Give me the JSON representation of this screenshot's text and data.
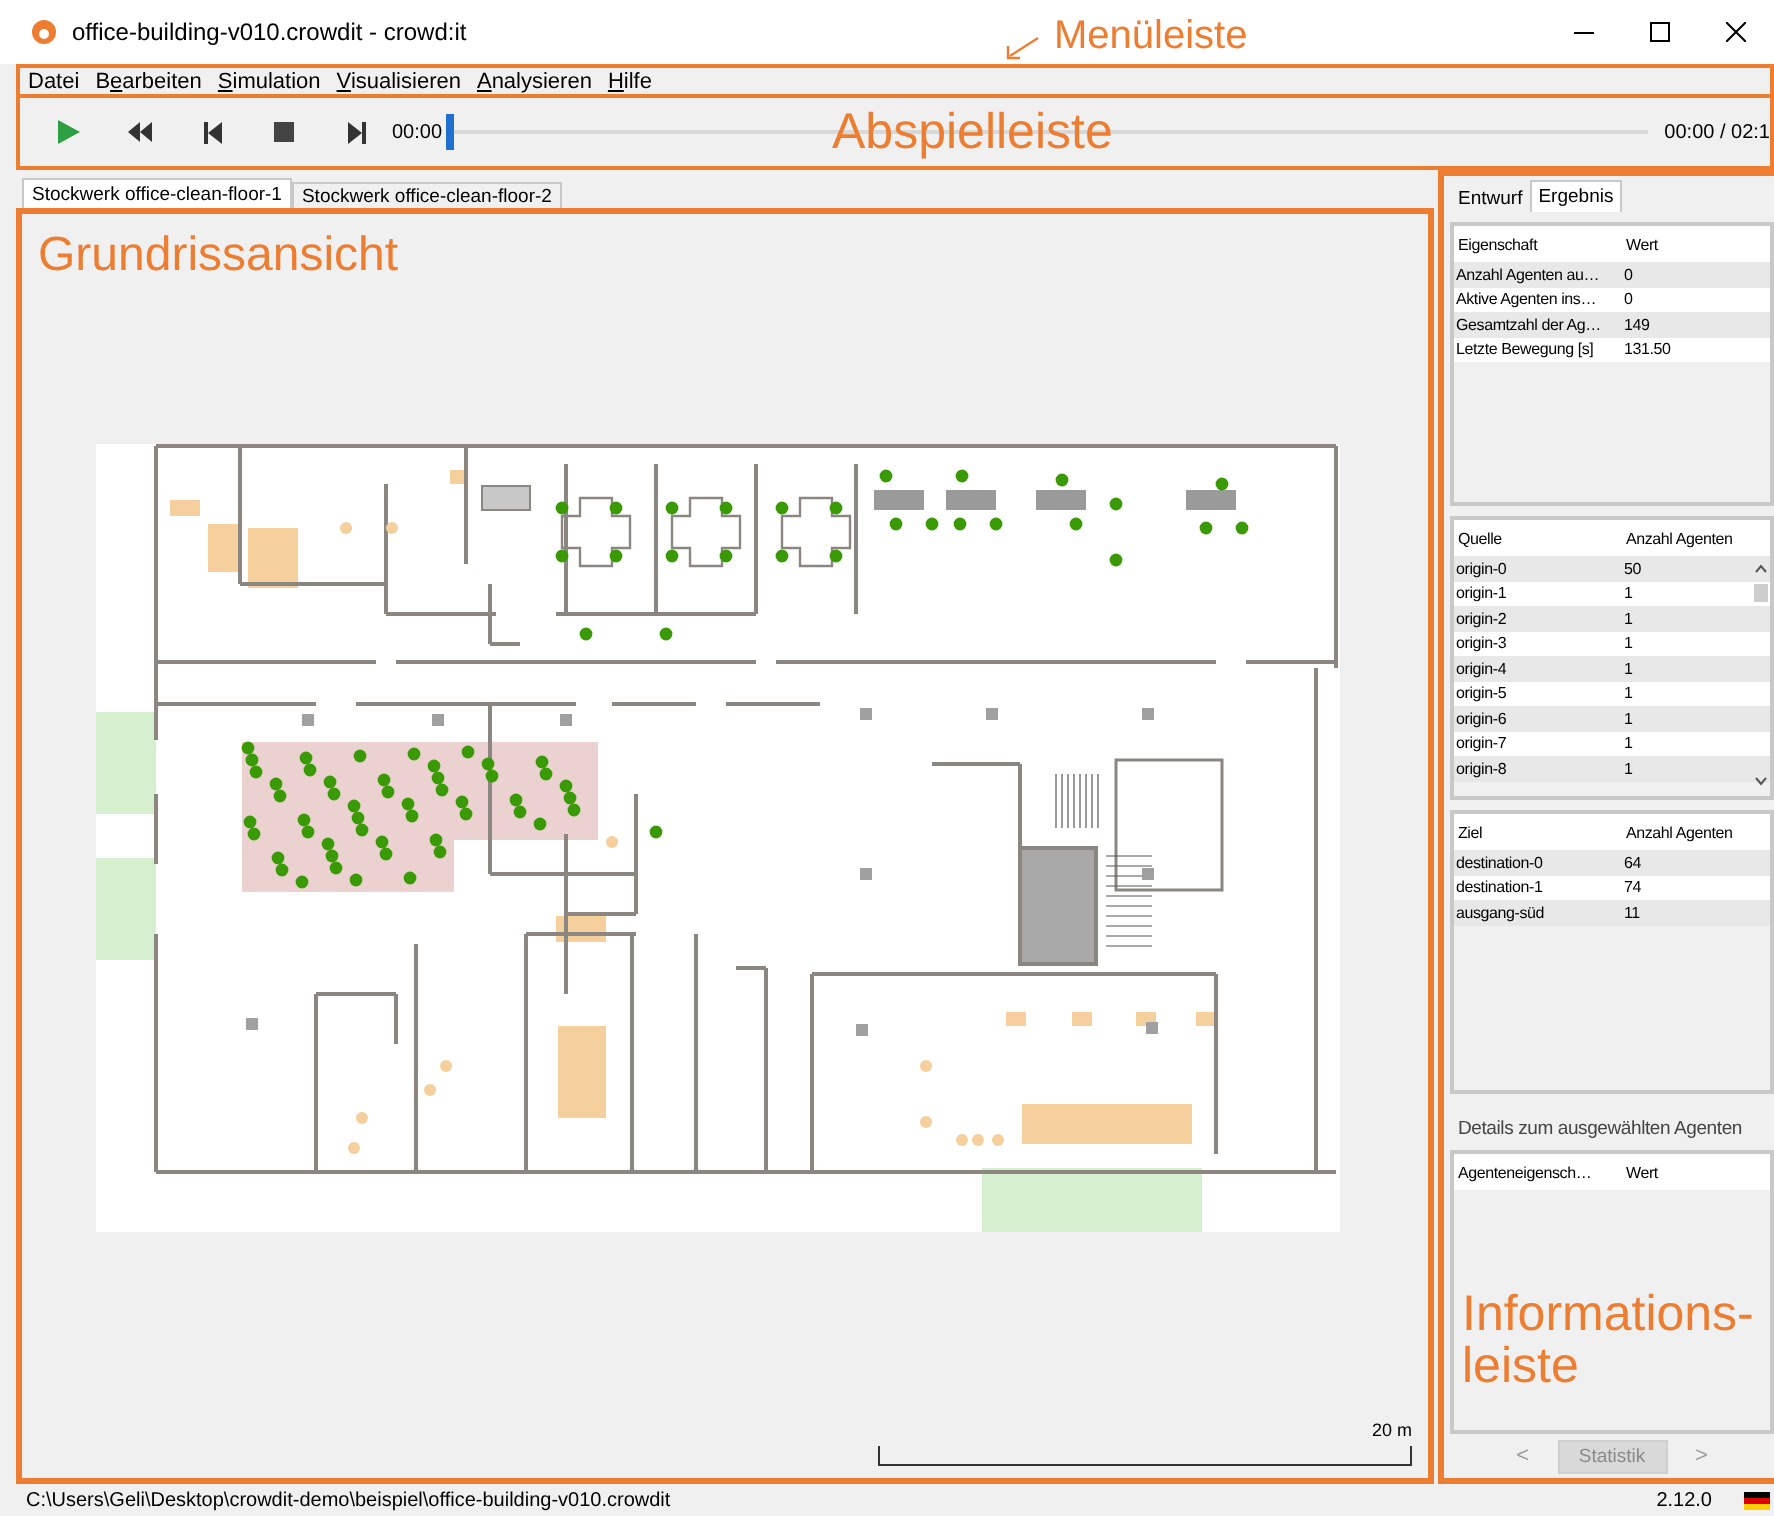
{
  "window": {
    "title": "office-building-v010.crowdit - crowd:it"
  },
  "menu": [
    {
      "before": "Datei"
    },
    {
      "before": "B",
      "underlined": "e",
      "after": "arbeiten"
    },
    {
      "underlined": "S",
      "after": "imulation"
    },
    {
      "underlined": "V",
      "after": "isualisieren"
    },
    {
      "underlined": "A",
      "after": "nalysieren"
    },
    {
      "underlined": "H",
      "after": "ilfe"
    }
  ],
  "player": {
    "controls": [
      {
        "kind": "play"
      },
      {
        "kind": "rewind"
      },
      {
        "kind": "first"
      },
      {
        "kind": "stop"
      },
      {
        "kind": "last"
      }
    ],
    "time": "00:00",
    "level": 0,
    "total": "00:00 / 02:1"
  },
  "floor_tabs": [
    {
      "label": "Stockwerk office-clean-floor-1",
      "selected": true
    },
    {
      "label": "Stockwerk office-clean-floor-2",
      "selected": false
    }
  ],
  "scale": "20 m",
  "info": {
    "tabs": [
      {
        "label": "Entwurf",
        "selected": false
      },
      {
        "label": "Ergebnis",
        "selected": true
      }
    ],
    "properties": {
      "columns": [
        "Eigenschaft",
        "Wert"
      ],
      "rows": [
        [
          "Anzahl Agenten au…",
          "0"
        ],
        [
          "Aktive Agenten ins…",
          "0"
        ],
        [
          "Gesamtzahl der Ag…",
          "149"
        ],
        [
          "Letzte Bewegung [s]",
          "131.50"
        ]
      ]
    },
    "sources": {
      "columns": [
        "Quelle",
        "Anzahl Agenten"
      ],
      "rows": [
        [
          "origin-0",
          "50"
        ],
        [
          "origin-1",
          "1"
        ],
        [
          "origin-2",
          "1"
        ],
        [
          "origin-3",
          "1"
        ],
        [
          "origin-4",
          "1"
        ],
        [
          "origin-5",
          "1"
        ],
        [
          "origin-6",
          "1"
        ],
        [
          "origin-7",
          "1"
        ],
        [
          "origin-8",
          "1"
        ]
      ]
    },
    "targets": {
      "columns": [
        "Ziel",
        "Anzahl Agenten"
      ],
      "rows": [
        [
          "destination-0",
          "64"
        ],
        [
          "destination-1",
          "74"
        ],
        [
          "ausgang-süd",
          "11"
        ]
      ]
    },
    "details_title": "Details zum ausgewählten Agenten",
    "agent": {
      "columns": [
        "Agenteneigensch…",
        "Wert"
      ]
    },
    "nav": {
      "prev": "<",
      "button": {
        "label": "Statistik",
        "disabled": true
      },
      "next": ">"
    }
  },
  "status_bar": {
    "path": "C:\\Users\\Geli\\Desktop\\crowdit-demo\\beispiel\\office-building-v010.crowdit",
    "version": "2.12.0"
  },
  "annotations": [
    {
      "kind": "menu",
      "label": "Menüleiste"
    },
    {
      "kind": "player",
      "label": "Abspielleiste"
    },
    {
      "kind": "plan",
      "label": "Grundrissansicht"
    },
    {
      "kind": "info",
      "label": "Informations-leiste"
    }
  ]
}
